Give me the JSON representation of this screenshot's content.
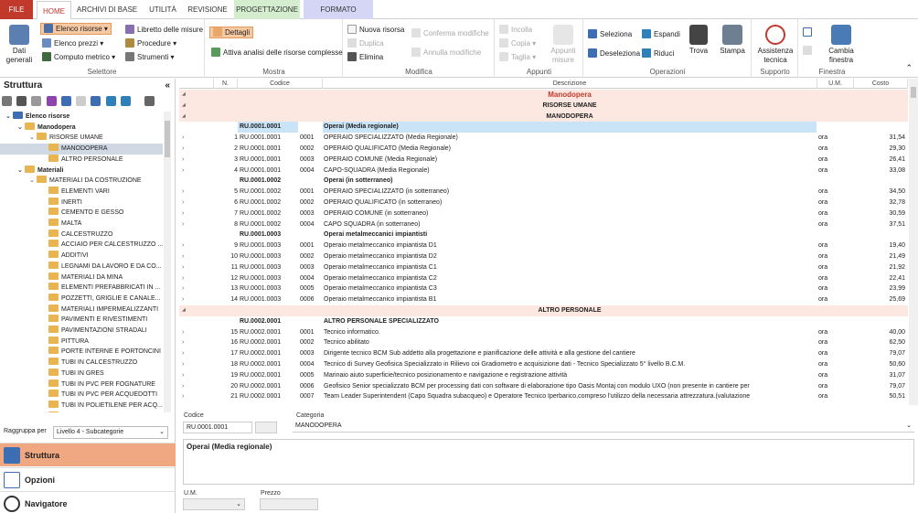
{
  "tabs": [
    "FILE",
    "HOME",
    "ARCHIVI DI BASE",
    "UTILITÀ",
    "REVISIONE",
    "PROGETTAZIONE",
    "FORMATO"
  ],
  "ribbon": {
    "dati_generali": "Dati\ngenerali",
    "elenco_risorse": "Elenco risorse",
    "elenco_prezzi": "Elenco prezzi",
    "computo_metrico": "Computo metrico",
    "libretto": "Libretto delle misure",
    "procedure": "Procedure",
    "strumenti": "Strumenti",
    "selettore": "Selettore",
    "dettagli": "Dettagli",
    "attiva_analisi": "Attiva analisi delle risorse complesse",
    "mostra": "Mostra",
    "nuova_risorsa": "Nuova risorsa",
    "duplica": "Duplica",
    "elimina": "Elimina",
    "conferma": "Conferma modifiche",
    "annulla": "Annulla modifiche",
    "modifica": "Modifica",
    "incolla": "Incolla",
    "copia": "Copia",
    "taglia": "Taglia",
    "appunti_misure": "Appunti\nmisure",
    "appunti": "Appunti",
    "seleziona": "Seleziona",
    "deseleziona": "Deseleziona",
    "espandi": "Espandi",
    "riduci": "Riduci",
    "trova": "Trova",
    "stampa": "Stampa",
    "operazioni": "Operazioni",
    "assistenza": "Assistenza\ntecnica",
    "supporto": "Supporto",
    "cambia_finestra": "Cambia\nfinestra",
    "finestra": "Finestra"
  },
  "left": {
    "title": "Struttura",
    "collapse": "«",
    "tree": [
      {
        "label": "Elenco risorse",
        "lvl": 0,
        "bold": true,
        "arrow": "⌄"
      },
      {
        "label": "Manodopera",
        "lvl": 1,
        "bold": true,
        "arrow": "⌄"
      },
      {
        "label": "RISORSE UMANE",
        "lvl": 2,
        "bold": false,
        "arrow": "⌄"
      },
      {
        "label": "MANODOPERA",
        "lvl": 3,
        "bold": false,
        "arrow": "",
        "sel": true
      },
      {
        "label": "ALTRO PERSONALE",
        "lvl": 3,
        "bold": false,
        "arrow": ""
      },
      {
        "label": "Materiali",
        "lvl": 1,
        "bold": true,
        "arrow": "⌄"
      },
      {
        "label": "MATERIALI DA COSTRUZIONE",
        "lvl": 2,
        "bold": false,
        "arrow": "⌄"
      },
      {
        "label": "ELEMENTI VARI",
        "lvl": 3,
        "arrow": ""
      },
      {
        "label": "INERTI",
        "lvl": 3,
        "arrow": ""
      },
      {
        "label": "CEMENTO E GESSO",
        "lvl": 3,
        "arrow": ""
      },
      {
        "label": "MALTA",
        "lvl": 3,
        "arrow": ""
      },
      {
        "label": "CALCESTRUZZO",
        "lvl": 3,
        "arrow": ""
      },
      {
        "label": "ACCIAIO PER CALCESTRUZZO ...",
        "lvl": 3,
        "arrow": ""
      },
      {
        "label": "ADDITIVI",
        "lvl": 3,
        "arrow": ""
      },
      {
        "label": "LEGNAMI DA LAVORO E DA CO...",
        "lvl": 3,
        "arrow": ""
      },
      {
        "label": "MATERIALI DA MINA",
        "lvl": 3,
        "arrow": ""
      },
      {
        "label": "ELEMENTI PREFABBRICATI IN ...",
        "lvl": 3,
        "arrow": ""
      },
      {
        "label": "POZZETTI, GRIGLIE E CANALE...",
        "lvl": 3,
        "arrow": ""
      },
      {
        "label": "MATERIALI IMPERMEALIZZANTI",
        "lvl": 3,
        "arrow": ""
      },
      {
        "label": "PAVIMENTI E RIVESTIMENTI",
        "lvl": 3,
        "arrow": ""
      },
      {
        "label": "PAVIMENTAZIONI STRADALI",
        "lvl": 3,
        "arrow": ""
      },
      {
        "label": "PITTURA",
        "lvl": 3,
        "arrow": ""
      },
      {
        "label": "PORTE INTERNE E PORTONCINI",
        "lvl": 3,
        "arrow": ""
      },
      {
        "label": "TUBI IN CALCESTRUZZO",
        "lvl": 3,
        "arrow": ""
      },
      {
        "label": "TUBI IN GRES",
        "lvl": 3,
        "arrow": ""
      },
      {
        "label": "TUBI IN PVC PER FOGNATURE",
        "lvl": 3,
        "arrow": ""
      },
      {
        "label": "TUBI IN PVC PER ACQUEDOTTI",
        "lvl": 3,
        "arrow": ""
      },
      {
        "label": "TUBI IN POLIETILENE PER ACQ...",
        "lvl": 3,
        "arrow": ""
      },
      {
        "label": "TUBI IN GHISA",
        "lvl": 3,
        "arrow": ""
      }
    ],
    "raggruppa_label": "Raggruppa per",
    "raggruppa_value": "Livello 4 - Subcategorie",
    "nav": [
      "Struttura",
      "Opzioni",
      "Navigatore"
    ]
  },
  "grid": {
    "headers": [
      "N.",
      "Codice",
      "Descrizione",
      "U.M.",
      "Costo"
    ],
    "rows": [
      {
        "type": "cat",
        "desc": "Manodopera",
        "style": "red"
      },
      {
        "type": "cat",
        "desc": "RISORSE UMANE",
        "style": "bold"
      },
      {
        "type": "cat",
        "desc": "MANODOPERA",
        "style": "bold"
      },
      {
        "type": "grp",
        "code": "RU.0001.0001",
        "desc": "Operai (Media regionale)",
        "sel": true
      },
      {
        "type": "item",
        "n": "1",
        "code": "RU.0001.0001",
        "sub": "0001",
        "desc": "OPERAIO SPECIALIZZATO (Media Regionale)",
        "um": "ora",
        "cost": "31,54"
      },
      {
        "type": "item",
        "n": "2",
        "code": "RU.0001.0001",
        "sub": "0002",
        "desc": "OPERAIO QUALIFICATO (Media Regionale)",
        "um": "ora",
        "cost": "29,30"
      },
      {
        "type": "item",
        "n": "3",
        "code": "RU.0001.0001",
        "sub": "0003",
        "desc": "OPERAIO COMUNE (Media Regionale)",
        "um": "ora",
        "cost": "26,41"
      },
      {
        "type": "item",
        "n": "4",
        "code": "RU.0001.0001",
        "sub": "0004",
        "desc": "CAPO-SQUADRA (Media Regionale)",
        "um": "ora",
        "cost": "33,08"
      },
      {
        "type": "grp",
        "code": "RU.0001.0002",
        "desc": "Operai (in sotterraneo)"
      },
      {
        "type": "item",
        "n": "5",
        "code": "RU.0001.0002",
        "sub": "0001",
        "desc": "OPERAIO SPECIALIZZATO (in sotterraneo)",
        "um": "ora",
        "cost": "34,50"
      },
      {
        "type": "item",
        "n": "6",
        "code": "RU.0001.0002",
        "sub": "0002",
        "desc": "OPERAIO QUALIFICATO (in sotterraneo)",
        "um": "ora",
        "cost": "32,78"
      },
      {
        "type": "item",
        "n": "7",
        "code": "RU.0001.0002",
        "sub": "0003",
        "desc": "OPERAIO COMUNE (in sotterraneo)",
        "um": "ora",
        "cost": "30,59"
      },
      {
        "type": "item",
        "n": "8",
        "code": "RU.0001.0002",
        "sub": "0004",
        "desc": "CAPO SQUADRA (in sotterraneo)",
        "um": "ora",
        "cost": "37,51"
      },
      {
        "type": "grp",
        "code": "RU.0001.0003",
        "desc": "Operai metalmeccanici impiantisti"
      },
      {
        "type": "item",
        "n": "9",
        "code": "RU.0001.0003",
        "sub": "0001",
        "desc": "Operaio metalmeccanico impiantista D1",
        "um": "ora",
        "cost": "19,40"
      },
      {
        "type": "item",
        "n": "10",
        "code": "RU.0001.0003",
        "sub": "0002",
        "desc": "Operaio metalmeccanico impiantista D2",
        "um": "ora",
        "cost": "21,49"
      },
      {
        "type": "item",
        "n": "11",
        "code": "RU.0001.0003",
        "sub": "0003",
        "desc": "Operaio metalmeccanico impiantista C1",
        "um": "ora",
        "cost": "21,92"
      },
      {
        "type": "item",
        "n": "12",
        "code": "RU.0001.0003",
        "sub": "0004",
        "desc": "Operaio metalmeccanico impiantista C2",
        "um": "ora",
        "cost": "22,41"
      },
      {
        "type": "item",
        "n": "13",
        "code": "RU.0001.0003",
        "sub": "0005",
        "desc": "Operaio metalmeccanico impiantista C3",
        "um": "ora",
        "cost": "23,99"
      },
      {
        "type": "item",
        "n": "14",
        "code": "RU.0001.0003",
        "sub": "0006",
        "desc": "Operaio metalmeccanico impiantista B1",
        "um": "ora",
        "cost": "25,69"
      },
      {
        "type": "cat",
        "desc": "ALTRO PERSONALE",
        "style": "bold"
      },
      {
        "type": "grp",
        "code": "RU.0002.0001",
        "desc": "ALTRO PERSONALE SPECIALIZZATO"
      },
      {
        "type": "item",
        "n": "15",
        "code": "RU.0002.0001",
        "sub": "0001",
        "desc": "Tecnico informatico.",
        "um": "ora",
        "cost": "40,00"
      },
      {
        "type": "item",
        "n": "16",
        "code": "RU.0002.0001",
        "sub": "0002",
        "desc": "Tecnico abilitato",
        "um": "ora",
        "cost": "62,50"
      },
      {
        "type": "item",
        "n": "17",
        "code": "RU.0002.0001",
        "sub": "0003",
        "desc": "Dirigente tecnico BCM Sub addetto alla progettazione e pianificazione delle attività e alla gestione del cantiere",
        "um": "ora",
        "cost": "79,07"
      },
      {
        "type": "item",
        "n": "18",
        "code": "RU.0002.0001",
        "sub": "0004",
        "desc": "Tecnico di Survey Geofisica Specializzato in Rilievo coi Gradiometro e acquisizione dati -  Tecnico Specializzato 5° livello  B.C.M.",
        "um": "ora",
        "cost": "50,60"
      },
      {
        "type": "item",
        "n": "19",
        "code": "RU.0002.0001",
        "sub": "0005",
        "desc": "Marinaio aiuto superficie/tecnico posizionamento e navigazione e registrazione attività",
        "um": "ora",
        "cost": "31,07"
      },
      {
        "type": "item",
        "n": "20",
        "code": "RU.0002.0001",
        "sub": "0006",
        "desc": "Geofisico Senior specializzato BCM per processing dati con software di elaborazione tipo Oasis Montaj con modulo UXO (non presente in cantiere per",
        "um": "ora",
        "cost": "79,07"
      },
      {
        "type": "item",
        "n": "21",
        "code": "RU.0002.0001",
        "sub": "0007",
        "desc": "Team Leader Superintendent (Capo Squadra subacqueo) e Operatore Tecnico Iperbarico,compreso l'utilizzo della necessaria attrezzatura.(valutazione",
        "um": "ora",
        "cost": "50,51"
      }
    ]
  },
  "details": {
    "codice_label": "Codice",
    "codice_value": "RU.0001.0001",
    "categoria_label": "Categoria",
    "categoria_value": "MANODOPERA",
    "descrizione": "Operai (Media regionale)",
    "um_label": "U.M.",
    "prezzo_label": "Prezzo"
  }
}
